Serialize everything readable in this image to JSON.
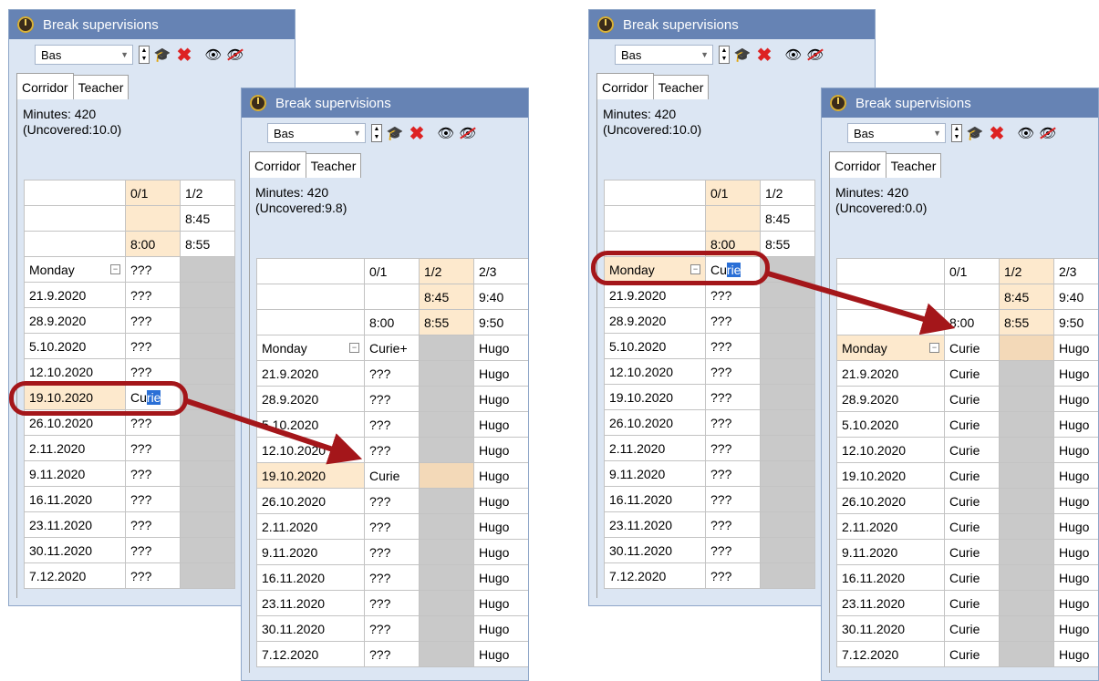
{
  "window_title": "Break supervisions",
  "combo_value": "Bas",
  "tabs": [
    "Corridor",
    "Teacher"
  ],
  "colors": {
    "titlebar": "#6683b4",
    "highlight": "#fde9cd",
    "arrow": "#a4161a",
    "selection": "#2a6fd6"
  },
  "icons": [
    "clock-icon",
    "spin-icon",
    "teacher-cap-icon",
    "delete-icon",
    "eye-icon",
    "eye-hidden-icon",
    "collapse-icon"
  ],
  "windows": [
    {
      "minutes_line1": "Minutes: 420",
      "minutes_line2": "(Uncovered:10.0)",
      "header_rows": [
        [
          "",
          "0/1",
          "1/2"
        ],
        [
          "",
          "",
          "8:45"
        ],
        [
          "",
          "8:00",
          "8:55"
        ]
      ],
      "rows": [
        [
          "Monday",
          "???",
          ""
        ],
        [
          "21.9.2020",
          "???",
          ""
        ],
        [
          "28.9.2020",
          "???",
          ""
        ],
        [
          "5.10.2020",
          "???",
          ""
        ],
        [
          "12.10.2020",
          "???",
          ""
        ],
        [
          "19.10.2020",
          "Curie",
          ""
        ],
        [
          "26.10.2020",
          "???",
          ""
        ],
        [
          "2.11.2020",
          "???",
          ""
        ],
        [
          "9.11.2020",
          "???",
          ""
        ],
        [
          "16.11.2020",
          "???",
          ""
        ],
        [
          "23.11.2020",
          "???",
          ""
        ],
        [
          "30.11.2020",
          "???",
          ""
        ],
        [
          "7.12.2020",
          "???",
          ""
        ]
      ]
    },
    {
      "minutes_line1": "Minutes: 420",
      "minutes_line2": "(Uncovered:9.8)",
      "header_rows": [
        [
          "",
          "0/1",
          "1/2",
          "2/3"
        ],
        [
          "",
          "",
          "8:45",
          "9:40"
        ],
        [
          "",
          "8:00",
          "8:55",
          "9:50"
        ]
      ],
      "rows": [
        [
          "Monday",
          "Curie+",
          "",
          "Hugo"
        ],
        [
          "21.9.2020",
          "???",
          "",
          "Hugo"
        ],
        [
          "28.9.2020",
          "???",
          "",
          "Hugo"
        ],
        [
          "5.10.2020",
          "???",
          "",
          "Hugo"
        ],
        [
          "12.10.2020",
          "???",
          "",
          "Hugo"
        ],
        [
          "19.10.2020",
          "Curie",
          "",
          "Hugo"
        ],
        [
          "26.10.2020",
          "???",
          "",
          "Hugo"
        ],
        [
          "2.11.2020",
          "???",
          "",
          "Hugo"
        ],
        [
          "9.11.2020",
          "???",
          "",
          "Hugo"
        ],
        [
          "16.11.2020",
          "???",
          "",
          "Hugo"
        ],
        [
          "23.11.2020",
          "???",
          "",
          "Hugo"
        ],
        [
          "30.11.2020",
          "???",
          "",
          "Hugo"
        ],
        [
          "7.12.2020",
          "???",
          "",
          "Hugo"
        ]
      ]
    },
    {
      "minutes_line1": "Minutes: 420",
      "minutes_line2": "(Uncovered:10.0)",
      "header_rows": [
        [
          "",
          "0/1",
          "1/2"
        ],
        [
          "",
          "",
          "8:45"
        ],
        [
          "",
          "8:00",
          "8:55"
        ]
      ],
      "rows": [
        [
          "Monday",
          "Curie",
          ""
        ],
        [
          "21.9.2020",
          "???",
          ""
        ],
        [
          "28.9.2020",
          "???",
          ""
        ],
        [
          "5.10.2020",
          "???",
          ""
        ],
        [
          "12.10.2020",
          "???",
          ""
        ],
        [
          "19.10.2020",
          "???",
          ""
        ],
        [
          "26.10.2020",
          "???",
          ""
        ],
        [
          "2.11.2020",
          "???",
          ""
        ],
        [
          "9.11.2020",
          "???",
          ""
        ],
        [
          "16.11.2020",
          "???",
          ""
        ],
        [
          "23.11.2020",
          "???",
          ""
        ],
        [
          "30.11.2020",
          "???",
          ""
        ],
        [
          "7.12.2020",
          "???",
          ""
        ]
      ]
    },
    {
      "minutes_line1": "Minutes: 420",
      "minutes_line2": "(Uncovered:0.0)",
      "header_rows": [
        [
          "",
          "0/1",
          "1/2",
          "2/3"
        ],
        [
          "",
          "",
          "8:45",
          "9:40"
        ],
        [
          "",
          "8:00",
          "8:55",
          "9:50"
        ]
      ],
      "rows": [
        [
          "Monday",
          "Curie",
          "",
          "Hugo"
        ],
        [
          "21.9.2020",
          "Curie",
          "",
          "Hugo"
        ],
        [
          "28.9.2020",
          "Curie",
          "",
          "Hugo"
        ],
        [
          "5.10.2020",
          "Curie",
          "",
          "Hugo"
        ],
        [
          "12.10.2020",
          "Curie",
          "",
          "Hugo"
        ],
        [
          "19.10.2020",
          "Curie",
          "",
          "Hugo"
        ],
        [
          "26.10.2020",
          "Curie",
          "",
          "Hugo"
        ],
        [
          "2.11.2020",
          "Curie",
          "",
          "Hugo"
        ],
        [
          "9.11.2020",
          "Curie",
          "",
          "Hugo"
        ],
        [
          "16.11.2020",
          "Curie",
          "",
          "Hugo"
        ],
        [
          "23.11.2020",
          "Curie",
          "",
          "Hugo"
        ],
        [
          "30.11.2020",
          "Curie",
          "",
          "Hugo"
        ],
        [
          "7.12.2020",
          "Curie",
          "",
          "Hugo"
        ]
      ]
    }
  ]
}
